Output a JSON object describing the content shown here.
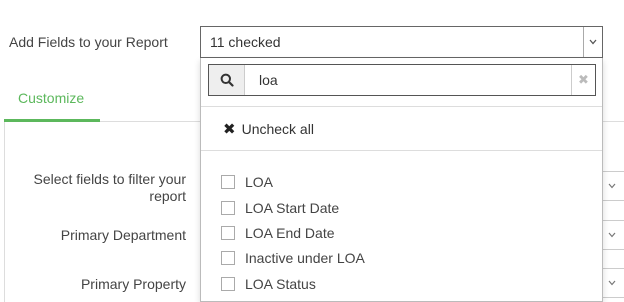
{
  "form": {
    "add_fields_label": "Add Fields to your Report",
    "selected_summary": "11 checked"
  },
  "tabs": [
    {
      "label": "Customize",
      "active": true
    }
  ],
  "filters": [
    {
      "label_line1": "Select fields to filter your",
      "label_line2": "report"
    },
    {
      "label": "Primary Department"
    },
    {
      "label": "Primary Property"
    }
  ],
  "dropdown": {
    "search_value": "loa",
    "uncheck_all_label": "Uncheck all",
    "options": [
      {
        "label": "LOA",
        "checked": false
      },
      {
        "label": "LOA Start Date",
        "checked": false
      },
      {
        "label": "LOA End Date",
        "checked": false
      },
      {
        "label": "Inactive under LOA",
        "checked": false
      },
      {
        "label": "LOA Status",
        "checked": false
      }
    ]
  },
  "colors": {
    "accent": "#5cb85c",
    "border": "#666666",
    "text": "#444444"
  },
  "icons": {
    "caret": "chevron-down-icon",
    "search": "search-icon",
    "clear": "clear-icon",
    "uncheck": "close-icon"
  }
}
